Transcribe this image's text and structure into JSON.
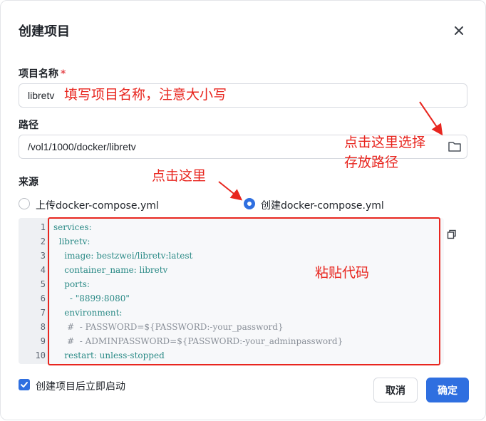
{
  "dialog": {
    "title": "创建项目",
    "close_icon": "close-icon"
  },
  "project_name": {
    "label": "项目名称",
    "required_mark": "*",
    "value": "libretv",
    "annotation": "填写项目名称，注意大小写"
  },
  "path": {
    "label": "路径",
    "value": "/vol1/1000/docker/libretv",
    "folder_icon": "folder-icon",
    "annotation_line1": "点击这里选择",
    "annotation_line2": "存放路径"
  },
  "source": {
    "label": "来源",
    "option_upload": "上传docker-compose.yml",
    "option_create": "创建docker-compose.yml",
    "selected": "option_create",
    "annotation": "点击这里"
  },
  "editor": {
    "line_numbers": [
      "1",
      "2",
      "3",
      "4",
      "5",
      "6",
      "7",
      "8",
      "9",
      "10"
    ],
    "lines": [
      "services:",
      "  libretv:",
      "    image: bestzwei/libretv:latest",
      "    container_name: libretv",
      "    ports:",
      "      - \"8899:8080\"",
      "    environment:",
      "     #  - PASSWORD=${PASSWORD:-your_password}",
      "     #  - ADMINPASSWORD=${PASSWORD:-your_adminpassword}",
      "    restart: unless-stopped"
    ],
    "annotation": "粘贴代码",
    "copy_icon": "copy-icon"
  },
  "auto_start": {
    "label": "创建项目后立即启动",
    "checked": true
  },
  "buttons": {
    "cancel": "取消",
    "confirm": "确定"
  },
  "colors": {
    "primary": "#2f6fe0",
    "annotation_red": "#e8261f"
  }
}
